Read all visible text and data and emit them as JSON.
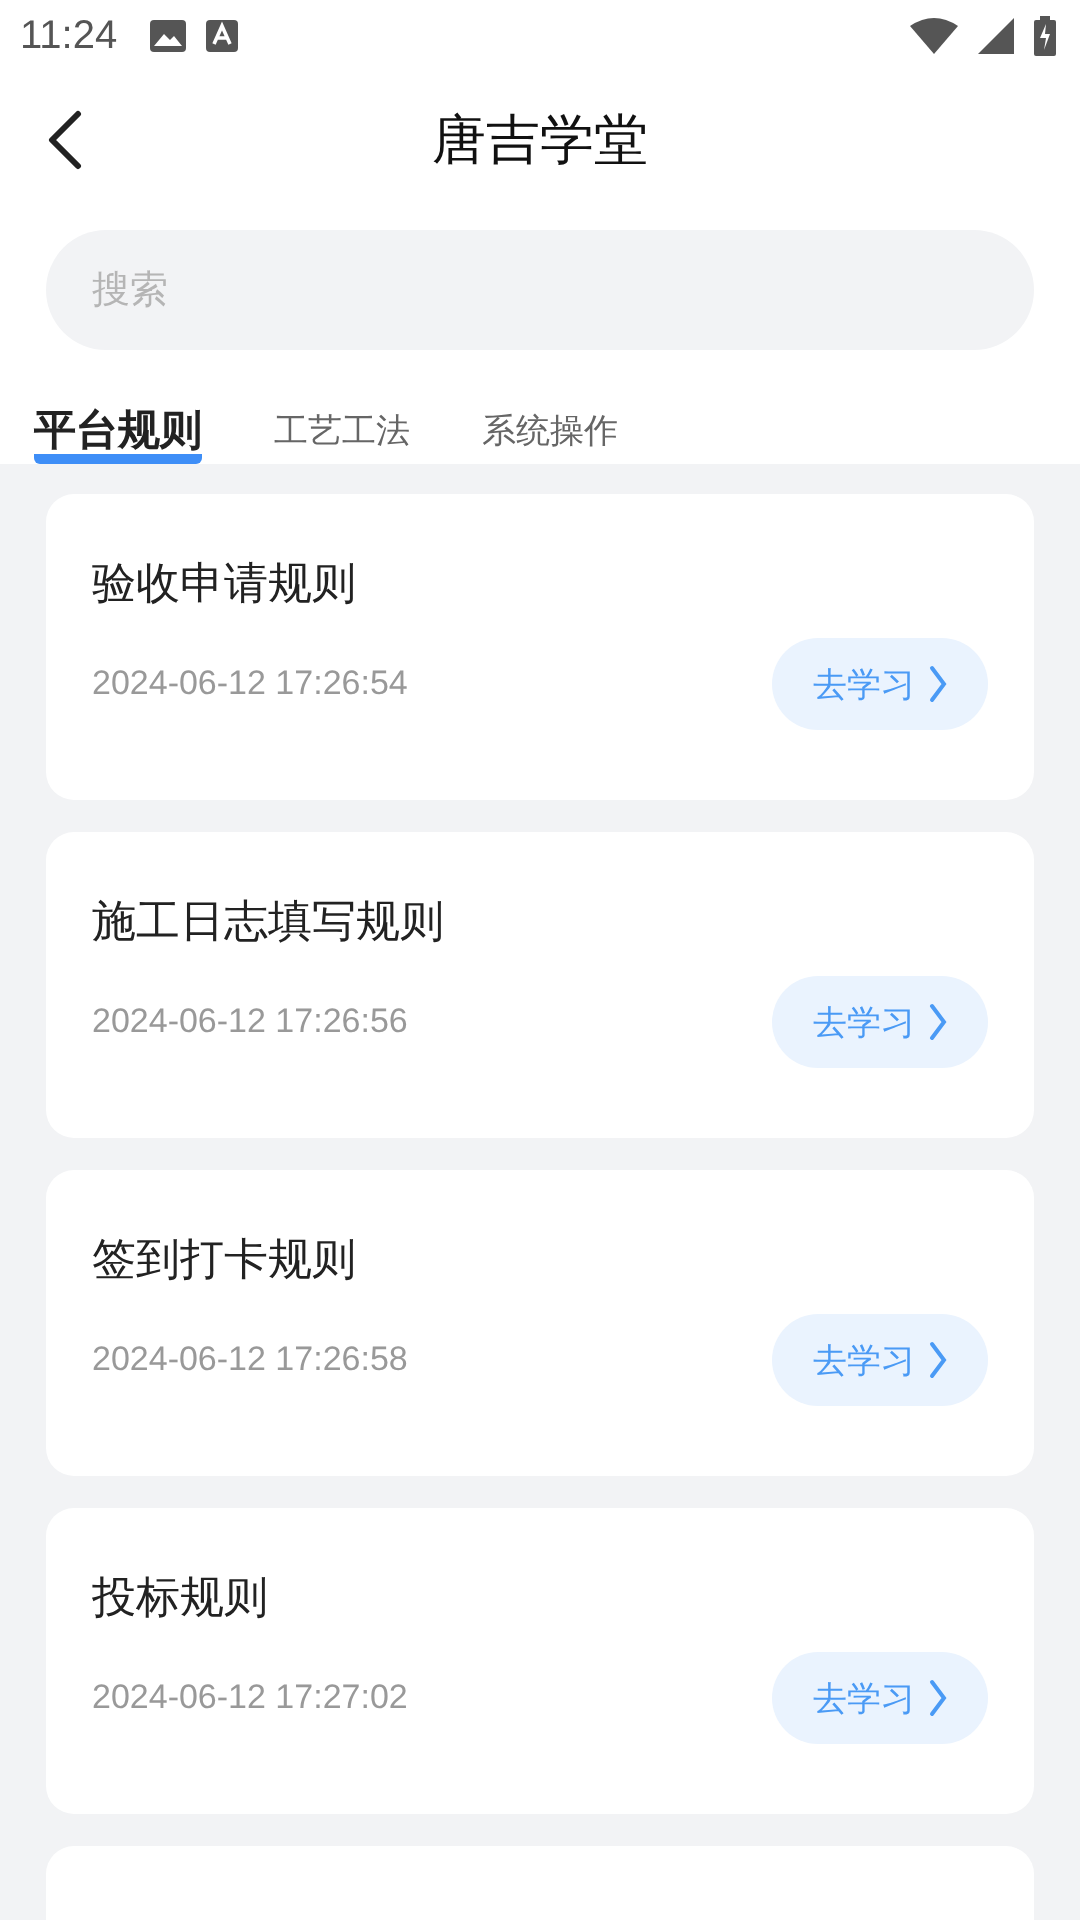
{
  "status_bar": {
    "time": "11:24"
  },
  "header": {
    "title": "唐吉学堂"
  },
  "search": {
    "placeholder": "搜索"
  },
  "tabs": [
    {
      "label": "平台规则",
      "selected": true
    },
    {
      "label": "工艺工法",
      "selected": false
    },
    {
      "label": "系统操作",
      "selected": false
    }
  ],
  "items": [
    {
      "title": "验收申请规则",
      "date": "2024-06-12 17:26:54",
      "action": "去学习"
    },
    {
      "title": "施工日志填写规则",
      "date": "2024-06-12 17:26:56",
      "action": "去学习"
    },
    {
      "title": "签到打卡规则",
      "date": "2024-06-12 17:26:58",
      "action": "去学习"
    },
    {
      "title": "投标规则",
      "date": "2024-06-12 17:27:02",
      "action": "去学习"
    }
  ]
}
